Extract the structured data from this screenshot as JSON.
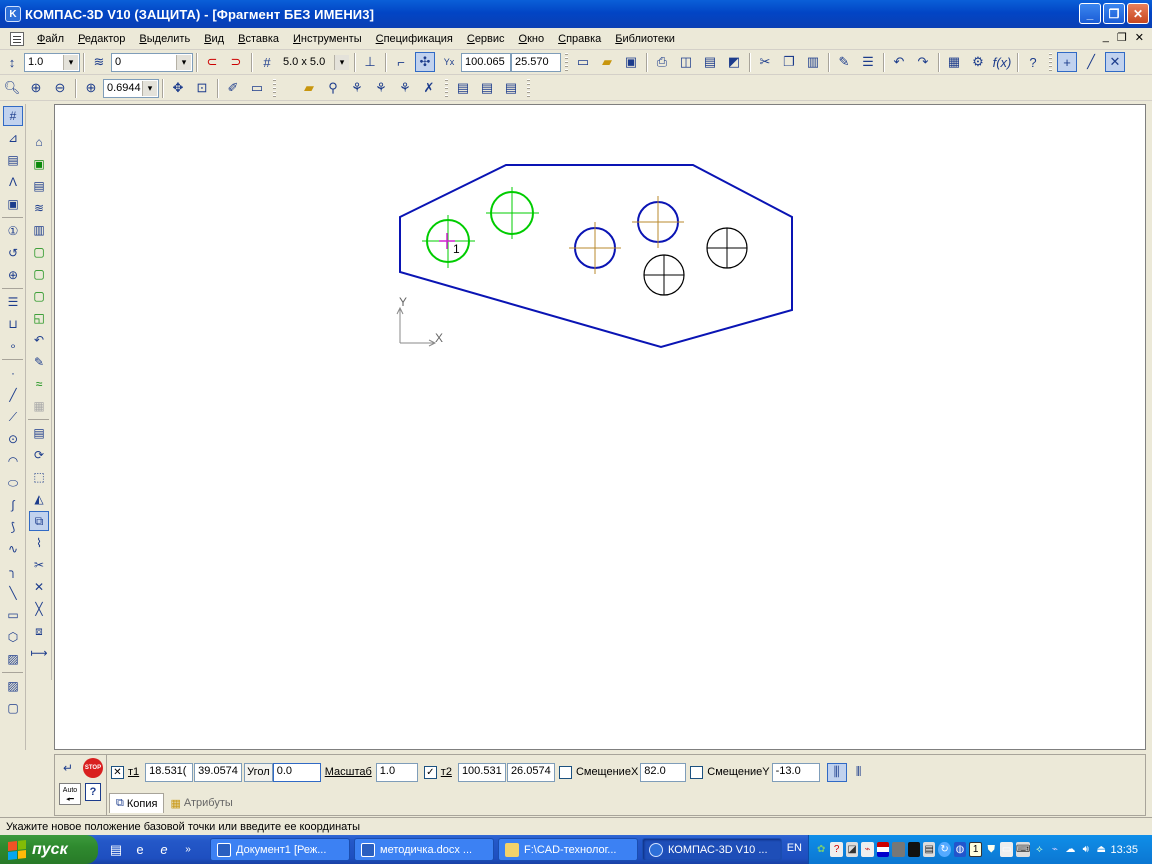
{
  "window": {
    "title": "КОМПАС-3D V10 (ЗАЩИТА) - [Фрагмент БЕЗ ИМЕНИ3]",
    "buttons": [
      "_",
      "❐",
      "✕"
    ]
  },
  "menu": {
    "items": [
      "Файл",
      "Редактор",
      "Выделить",
      "Вид",
      "Вставка",
      "Инструменты",
      "Спецификация",
      "Сервис",
      "Окно",
      "Справка",
      "Библиотеки"
    ],
    "mdi_buttons": [
      "_",
      "❐",
      "✕"
    ]
  },
  "toolbar1": {
    "line_width": "1.0",
    "layer": "0",
    "grid_step": "5.0 x 5.0",
    "coord_x": "100.065",
    "coord_y": "25.570"
  },
  "toolbar2": {
    "zoom": "0.6944"
  },
  "drawing": {
    "point_label": "1",
    "axis_x": "X",
    "axis_y": "Y",
    "colors": {
      "outline": "#0a14b4",
      "green": "#00cc00",
      "black": "#000000",
      "center": "#b88a2e",
      "point": "#d020d0"
    }
  },
  "properties": {
    "t1_label": "т1",
    "t1_x": "18.531(",
    "t1_y": "39.0574",
    "angle_label": "Угол",
    "angle": "0.0",
    "scale_label": "Масштаб",
    "scale": "1.0",
    "t2_label": "т2",
    "t2_x": "100.531",
    "t2_y": "26.0574",
    "offset_x_label": "СмещениеX",
    "offset_x": "82.0",
    "offset_y_label": "СмещениеY",
    "offset_y": "-13.0",
    "tabs": [
      "Копия",
      "Атрибуты"
    ],
    "auto_label": "Auto",
    "stop_label": "STOP"
  },
  "status": {
    "message": "Укажите новое положение базовой точки или введите ее координаты"
  },
  "taskbar": {
    "start": "пуск",
    "tasks": [
      "Документ1 [Реж...",
      "методичка.docx ...",
      "F:\\CAD-технолог...",
      "КОМПАС-3D V10 ..."
    ],
    "language": "EN",
    "clock": "13:35"
  }
}
